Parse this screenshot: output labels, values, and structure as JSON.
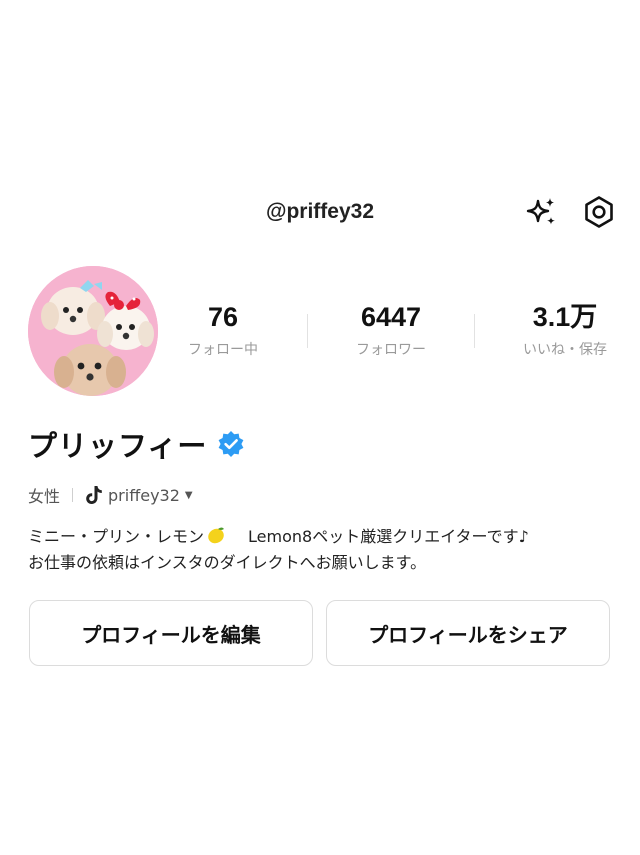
{
  "header": {
    "handle": "@priffey32",
    "sparkle_icon": "sparkle-icon",
    "settings_icon": "gear-icon"
  },
  "profile": {
    "name": "プリッフィー",
    "verified": true,
    "gender": "女性",
    "tiktok_handle": "priffey32"
  },
  "stats": [
    {
      "value": "76",
      "label": "フォロー中"
    },
    {
      "value": "6447",
      "label": "フォロワー"
    },
    {
      "value": "3.1万",
      "label": "いいね・保存"
    }
  ],
  "bio": {
    "line1_a": "ミニー・プリン・レモン",
    "line1_b": "Lemon8ペット厳選クリエイターです♪",
    "line2": "お仕事の依頼はインスタのダイレクトへお願いします。"
  },
  "buttons": {
    "edit_profile": "プロフィールを編集",
    "share_profile": "プロフィールをシェア"
  },
  "colors": {
    "verified": "#2d9cf4",
    "avatar_bg": "#f6b3cf",
    "divider": "#e2e2e2"
  }
}
